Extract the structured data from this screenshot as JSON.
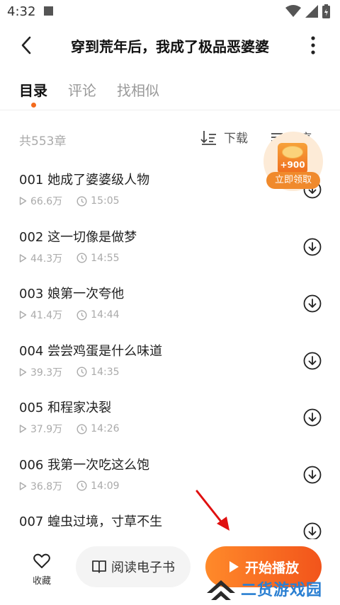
{
  "status_bar": {
    "time": "4:32"
  },
  "header": {
    "title": "穿到荒年后，我成了极品恶婆婆"
  },
  "tabs": [
    {
      "label": "目录"
    },
    {
      "label": "评论"
    },
    {
      "label": "找相似"
    }
  ],
  "list_header": {
    "chapter_count": "共553章",
    "download_label": "下载",
    "sort_label": "倒序"
  },
  "chapters": [
    {
      "title": "001 她成了婆婆级人物",
      "plays": "66.6万",
      "duration": "15:05"
    },
    {
      "title": "002 这一切像是做梦",
      "plays": "44.3万",
      "duration": "14:55"
    },
    {
      "title": "003 娘第一次夸他",
      "plays": "41.4万",
      "duration": "14:44"
    },
    {
      "title": "004 尝尝鸡蛋是什么味道",
      "plays": "39.3万",
      "duration": "14:35"
    },
    {
      "title": "005 和程家决裂",
      "plays": "37.9万",
      "duration": "14:26"
    },
    {
      "title": "006 我第一次吃这么饱",
      "plays": "36.8万",
      "duration": "14:09"
    },
    {
      "title": "007 蝗虫过境，寸草不生",
      "plays": "",
      "duration": ""
    }
  ],
  "reward": {
    "amount": "+900",
    "claim_label": "立即领取"
  },
  "bottom_bar": {
    "favorite_label": "收藏",
    "read_ebook_label": "阅读电子书",
    "play_label": "开始播放"
  },
  "watermark": {
    "text": "二货游戏园"
  },
  "colors": {
    "accent": "#f36a1c",
    "play_gradient_start": "#ff8a2a",
    "play_gradient_end": "#f2541b",
    "watermark": "#2a7fd2"
  }
}
